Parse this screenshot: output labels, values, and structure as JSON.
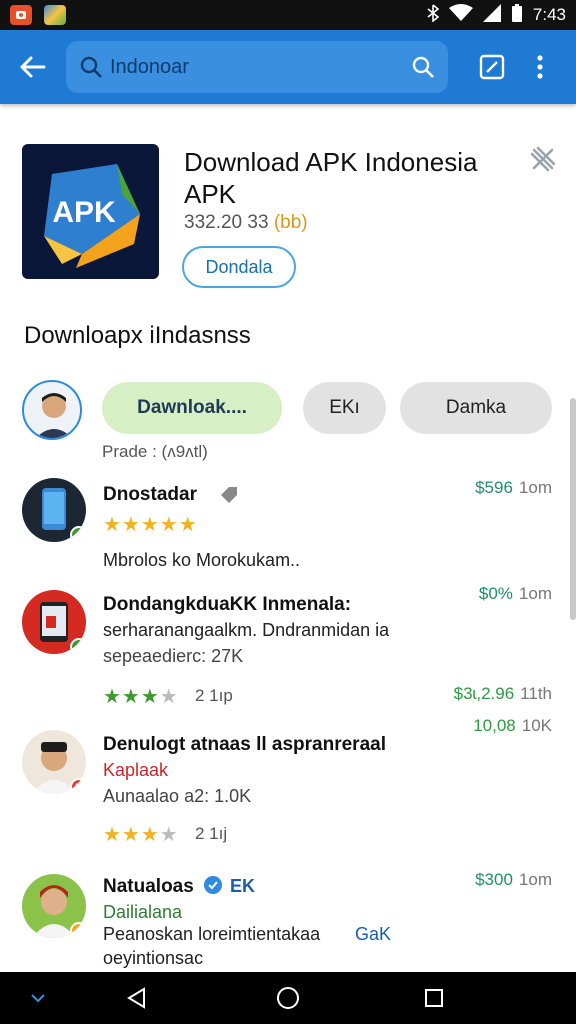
{
  "status_bar": {
    "time": "7:43",
    "icons": [
      "notification-app-icon",
      "photos-icon",
      "bluetooth-icon",
      "wifi-icon",
      "signal-icon",
      "battery-icon"
    ]
  },
  "appbar": {
    "search_value": "Indonoar",
    "icons": [
      "back-arrow-icon",
      "search-icon",
      "edit-icon",
      "more-vert-icon"
    ],
    "color": "#1f7ad4"
  },
  "app": {
    "title": "Download APK Indonesia APK",
    "meta": "332.20 33",
    "badge": "(bb)",
    "button": "Dondala",
    "logo_text": "APK"
  },
  "section": {
    "title": "Downloapx iIndasnss"
  },
  "chips": [
    {
      "label": "Dawnloak...."
    },
    {
      "label": "EKı"
    },
    {
      "label": "Damka"
    }
  ],
  "price_label": "Prade : (ʌ9ʌtl)",
  "items": [
    {
      "title": "Dnostadar",
      "lines": [
        "Mbrolos ko Morokukam.."
      ],
      "price": "$596",
      "time": "1om",
      "stars": 5,
      "rating_text": ""
    },
    {
      "title": "DondangkduaKK Inmenala:",
      "lines": [
        "serharanangaalkm. Dndranmidan ia",
        "sepeaedierc: 27K"
      ],
      "price": "$0%",
      "time": "1om",
      "stars": 3,
      "rating_text": "2 1ıp",
      "extra_price": "$3ɩ,2.96",
      "extra_time": "11th"
    },
    {
      "title": "Denulogt atnaas ll aspranreraal",
      "lines": [
        "Kaplaak",
        "Aunaalao a2: 1.0K"
      ],
      "price": "10,08",
      "time": "10K",
      "stars": 3,
      "rating_text": "2 1ıj"
    },
    {
      "title": "Natualoas",
      "tag": "EK",
      "lines": [
        "Dailialana",
        "Peanoskan loreimtientakaa",
        "oeyintionsac"
      ],
      "price": "$300",
      "time": "1om",
      "link": "GaK"
    }
  ],
  "nav": {
    "icons": [
      "collapse-icon",
      "back-triangle-icon",
      "home-circle-icon",
      "recents-square-icon"
    ]
  }
}
